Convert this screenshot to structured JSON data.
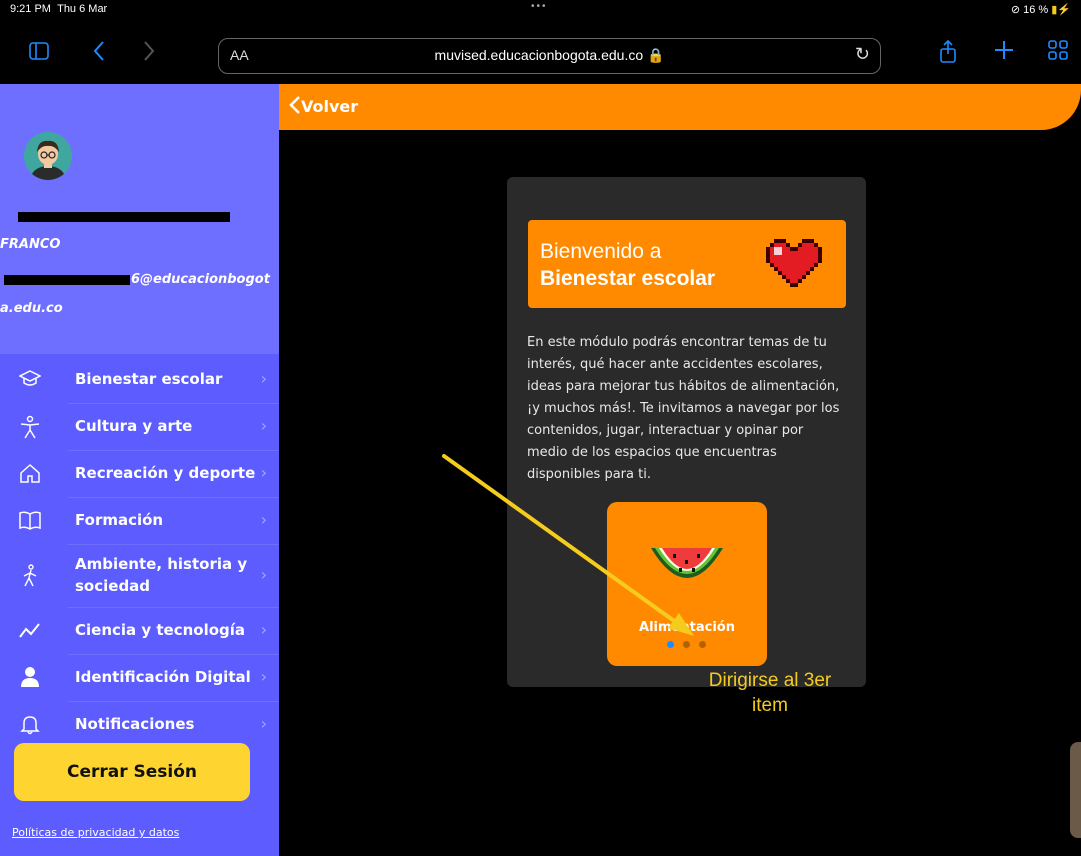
{
  "status_bar": {
    "time": "9:21 PM",
    "date": "Thu 6 Mar",
    "battery": "16 %"
  },
  "browser": {
    "text_size_label": "AA",
    "url": "muvised.educacionbogota.edu.co 🔒"
  },
  "sidebar": {
    "user_name": "FRANCO",
    "email_partial": "6@educacionbogot",
    "email_domain": "a.edu.co",
    "menu": [
      {
        "label": "Bienestar escolar",
        "icon": "graduation-cap-icon"
      },
      {
        "label": "Cultura y arte",
        "icon": "person-arms-up-icon"
      },
      {
        "label": "Recreación y deporte",
        "icon": "house-icon"
      },
      {
        "label": "Formación",
        "icon": "book-icon"
      },
      {
        "label": "Ambiente, historia y sociedad",
        "icon": "walking-person-icon"
      },
      {
        "label": "Ciencia y tecnología",
        "icon": "trend-line-icon"
      },
      {
        "label": "Identificación Digital",
        "icon": "user-icon"
      },
      {
        "label": "Notificaciones",
        "icon": "bell-icon"
      }
    ],
    "logout_label": "Cerrar Sesión",
    "privacy_link": "Políticas de privacidad y datos"
  },
  "header": {
    "back_label": "Volver"
  },
  "main": {
    "welcome_line1": "Bienvenido a",
    "welcome_line2": "Bienestar escolar",
    "description": "En este módulo podrás encontrar temas de tu interés, qué hacer ante accidentes escolares, ideas para mejorar tus hábitos de alimentación, ¡y muchos más!. Te invitamos a navegar por los contenidos, jugar, interactuar y opinar por medio de los espacios que encuentras disponibles para ti.",
    "carousel_item_label": "Alimentación",
    "carousel_active_index": 1,
    "carousel_total": 3
  },
  "annotation": {
    "line1": "Dirigirse al 3er",
    "line2": "item"
  },
  "colors": {
    "sidebar": "#5c5cff",
    "accent": "#ff8a00",
    "logout": "#fdd430",
    "annotation": "#f5cc1e",
    "browser_tint": "#1e8bff"
  }
}
